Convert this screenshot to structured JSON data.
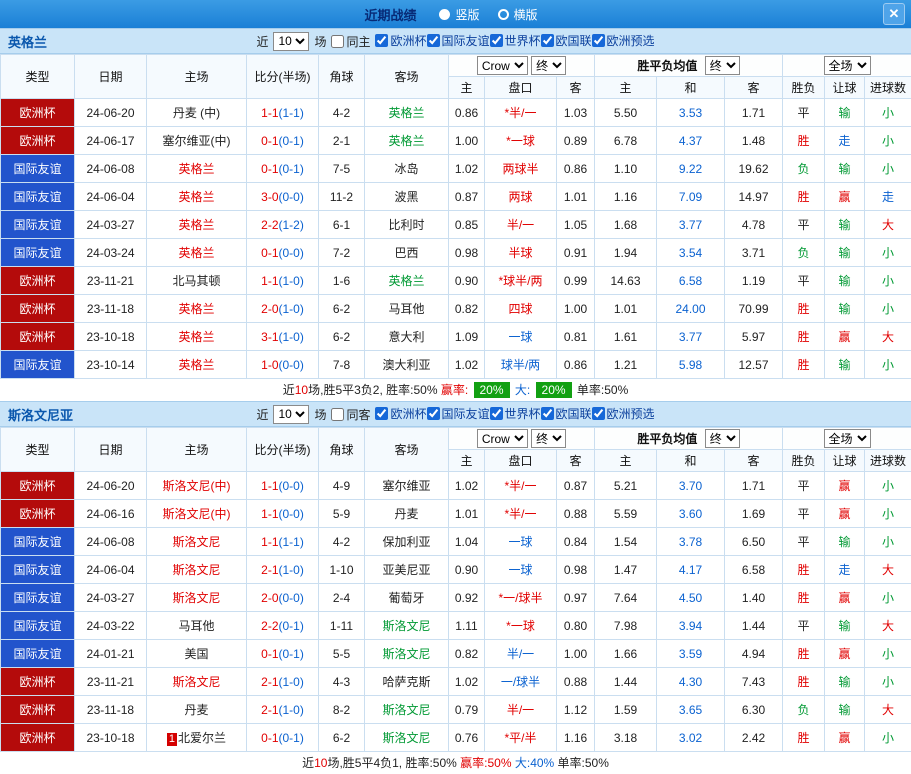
{
  "topbar": {
    "title": "近期战绩",
    "vertical_label": "竖版",
    "horizontal_label": "横版",
    "close_glyph": "✕"
  },
  "controls": {
    "crow_source": "Crow",
    "final_label": "终",
    "avg_label": "胜平负均值",
    "scope_label": "全场"
  },
  "filters": {
    "near_label": "近",
    "games_label": "场",
    "competitions": [
      "欧洲杯",
      "国际友谊",
      "世界杯",
      "欧国联",
      "欧洲预选"
    ],
    "comp_checked": [
      true,
      true,
      true,
      true,
      true
    ]
  },
  "columns": {
    "type": "类型",
    "date": "日期",
    "home": "主场",
    "score": "比分(半场)",
    "corner": "角球",
    "away": "客场",
    "odds_home": "主",
    "handicap": "盘口",
    "odds_away": "客",
    "avg_home": "主",
    "avg_draw": "和",
    "avg_away": "客",
    "result": "胜负",
    "handicap_result": "让球",
    "goals": "进球数"
  },
  "sections": [
    {
      "team": "英格兰",
      "count": "10",
      "same_label": "同主",
      "rows": [
        {
          "league": "欧洲杯",
          "league_color": "red",
          "date": "24-06-20",
          "home": "丹麦 (中)",
          "home_color": "black",
          "score": "1-1",
          "half": "(1-1)",
          "corners": "4-2",
          "away": "英格兰",
          "away_color": "green",
          "odds_home": "0.86",
          "handicap": "*半/一",
          "handicap_color": "red",
          "odds_away": "1.03",
          "avg_home": "5.50",
          "avg_draw": "3.53",
          "avg_away": "1.71",
          "wdl": "平",
          "wdl_color": "black",
          "hcp": "输",
          "hcp_color": "green",
          "goal": "小",
          "goal_color": "green"
        },
        {
          "league": "欧洲杯",
          "league_color": "red",
          "date": "24-06-17",
          "home": "塞尔维亚(中)",
          "home_color": "black",
          "score": "0-1",
          "half": "(0-1)",
          "corners": "2-1",
          "away": "英格兰",
          "away_color": "green",
          "odds_home": "1.00",
          "handicap": "*一球",
          "handicap_color": "red",
          "odds_away": "0.89",
          "avg_home": "6.78",
          "avg_draw": "4.37",
          "avg_away": "1.48",
          "wdl": "胜",
          "wdl_color": "red",
          "hcp": "走",
          "hcp_color": "blue",
          "goal": "小",
          "goal_color": "green"
        },
        {
          "league": "国际友谊",
          "league_color": "blue",
          "date": "24-06-08",
          "home": "英格兰",
          "home_color": "red",
          "score": "0-1",
          "half": "(0-1)",
          "corners": "7-5",
          "away": "冰岛",
          "away_color": "black",
          "odds_home": "1.02",
          "handicap": "两球半",
          "handicap_color": "red",
          "odds_away": "0.86",
          "avg_home": "1.10",
          "avg_draw": "9.22",
          "avg_away": "19.62",
          "wdl": "负",
          "wdl_color": "green",
          "hcp": "输",
          "hcp_color": "green",
          "goal": "小",
          "goal_color": "green"
        },
        {
          "league": "国际友谊",
          "league_color": "blue",
          "date": "24-06-04",
          "home": "英格兰",
          "home_color": "red",
          "score": "3-0",
          "half": "(0-0)",
          "corners": "11-2",
          "away": "波黑",
          "away_color": "black",
          "odds_home": "0.87",
          "handicap": "两球",
          "handicap_color": "red",
          "odds_away": "1.01",
          "avg_home": "1.16",
          "avg_draw": "7.09",
          "avg_away": "14.97",
          "wdl": "胜",
          "wdl_color": "red",
          "hcp": "赢",
          "hcp_color": "red",
          "goal": "走",
          "goal_color": "blue"
        },
        {
          "league": "国际友谊",
          "league_color": "blue",
          "date": "24-03-27",
          "home": "英格兰",
          "home_color": "red",
          "score": "2-2",
          "half": "(1-2)",
          "corners": "6-1",
          "away": "比利时",
          "away_color": "black",
          "odds_home": "0.85",
          "handicap": "半/一",
          "handicap_color": "red",
          "odds_away": "1.05",
          "avg_home": "1.68",
          "avg_draw": "3.77",
          "avg_away": "4.78",
          "wdl": "平",
          "wdl_color": "black",
          "hcp": "输",
          "hcp_color": "green",
          "goal": "大",
          "goal_color": "red"
        },
        {
          "league": "国际友谊",
          "league_color": "blue",
          "date": "24-03-24",
          "home": "英格兰",
          "home_color": "red",
          "score": "0-1",
          "half": "(0-0)",
          "corners": "7-2",
          "away": "巴西",
          "away_color": "black",
          "odds_home": "0.98",
          "handicap": "半球",
          "handicap_color": "red",
          "odds_away": "0.91",
          "avg_home": "1.94",
          "avg_draw": "3.54",
          "avg_away": "3.71",
          "wdl": "负",
          "wdl_color": "green",
          "hcp": "输",
          "hcp_color": "green",
          "goal": "小",
          "goal_color": "green"
        },
        {
          "league": "欧洲杯",
          "league_color": "red",
          "date": "23-11-21",
          "home": "北马其顿",
          "home_color": "black",
          "score": "1-1",
          "half": "(1-0)",
          "corners": "1-6",
          "away": "英格兰",
          "away_color": "green",
          "odds_home": "0.90",
          "handicap": "*球半/两",
          "handicap_color": "red",
          "odds_away": "0.99",
          "avg_home": "14.63",
          "avg_draw": "6.58",
          "avg_away": "1.19",
          "wdl": "平",
          "wdl_color": "black",
          "hcp": "输",
          "hcp_color": "green",
          "goal": "小",
          "goal_color": "green"
        },
        {
          "league": "欧洲杯",
          "league_color": "red",
          "date": "23-11-18",
          "home": "英格兰",
          "home_color": "red",
          "score": "2-0",
          "half": "(1-0)",
          "corners": "6-2",
          "away": "马耳他",
          "away_color": "black",
          "odds_home": "0.82",
          "handicap": "四球",
          "handicap_color": "red",
          "odds_away": "1.00",
          "avg_home": "1.01",
          "avg_draw": "24.00",
          "avg_away": "70.99",
          "wdl": "胜",
          "wdl_color": "red",
          "hcp": "输",
          "hcp_color": "green",
          "goal": "小",
          "goal_color": "green"
        },
        {
          "league": "欧洲杯",
          "league_color": "red",
          "date": "23-10-18",
          "home": "英格兰",
          "home_color": "red",
          "score": "3-1",
          "half": "(1-0)",
          "corners": "6-2",
          "away": "意大利",
          "away_color": "black",
          "odds_home": "1.09",
          "handicap": "一球",
          "handicap_color": "blue",
          "odds_away": "0.81",
          "avg_home": "1.61",
          "avg_draw": "3.77",
          "avg_away": "5.97",
          "wdl": "胜",
          "wdl_color": "red",
          "hcp": "赢",
          "hcp_color": "red",
          "goal": "大",
          "goal_color": "red"
        },
        {
          "league": "国际友谊",
          "league_color": "blue",
          "date": "23-10-14",
          "home": "英格兰",
          "home_color": "red",
          "score": "1-0",
          "half": "(0-0)",
          "corners": "7-8",
          "away": "澳大利亚",
          "away_color": "black",
          "odds_home": "1.02",
          "handicap": "球半/两",
          "handicap_color": "blue",
          "odds_away": "0.86",
          "avg_home": "1.21",
          "avg_draw": "5.98",
          "avg_away": "12.57",
          "wdl": "胜",
          "wdl_color": "red",
          "hcp": "输",
          "hcp_color": "green",
          "goal": "小",
          "goal_color": "green"
        }
      ],
      "summary": [
        {
          "text": "近",
          "color": "black"
        },
        {
          "text": "10",
          "color": "red"
        },
        {
          "text": "场,胜5平3负2, 胜率:50% ",
          "color": "black"
        },
        {
          "text": "赢率: ",
          "color": "red"
        },
        {
          "text": "20%",
          "badge": true
        },
        {
          "text": " 大: ",
          "color": "blue"
        },
        {
          "text": "20%",
          "badge": true
        },
        {
          "text": " 单率:50%",
          "color": "black"
        }
      ]
    },
    {
      "team": "斯洛文尼亚",
      "count": "10",
      "same_label": "同客",
      "rows": [
        {
          "league": "欧洲杯",
          "league_color": "red",
          "date": "24-06-20",
          "home": "斯洛文尼(中)",
          "home_color": "red",
          "score": "1-1",
          "half": "(0-0)",
          "corners": "4-9",
          "away": "塞尔维亚",
          "away_color": "black",
          "odds_home": "1.02",
          "handicap": "*半/一",
          "handicap_color": "red",
          "odds_away": "0.87",
          "avg_home": "5.21",
          "avg_draw": "3.70",
          "avg_away": "1.71",
          "wdl": "平",
          "wdl_color": "black",
          "hcp": "赢",
          "hcp_color": "red",
          "goal": "小",
          "goal_color": "green"
        },
        {
          "league": "欧洲杯",
          "league_color": "red",
          "date": "24-06-16",
          "home": "斯洛文尼(中)",
          "home_color": "red",
          "score": "1-1",
          "half": "(0-0)",
          "corners": "5-9",
          "away": "丹麦",
          "away_color": "black",
          "odds_home": "1.01",
          "handicap": "*半/一",
          "handicap_color": "red",
          "odds_away": "0.88",
          "avg_home": "5.59",
          "avg_draw": "3.60",
          "avg_away": "1.69",
          "wdl": "平",
          "wdl_color": "black",
          "hcp": "赢",
          "hcp_color": "red",
          "goal": "小",
          "goal_color": "green"
        },
        {
          "league": "国际友谊",
          "league_color": "blue",
          "date": "24-06-08",
          "home": "斯洛文尼",
          "home_color": "red",
          "score": "1-1",
          "half": "(1-1)",
          "corners": "4-2",
          "away": "保加利亚",
          "away_color": "black",
          "odds_home": "1.04",
          "handicap": "一球",
          "handicap_color": "blue",
          "odds_away": "0.84",
          "avg_home": "1.54",
          "avg_draw": "3.78",
          "avg_away": "6.50",
          "wdl": "平",
          "wdl_color": "black",
          "hcp": "输",
          "hcp_color": "green",
          "goal": "小",
          "goal_color": "green"
        },
        {
          "league": "国际友谊",
          "league_color": "blue",
          "date": "24-06-04",
          "home": "斯洛文尼",
          "home_color": "red",
          "score": "2-1",
          "half": "(1-0)",
          "corners": "1-10",
          "away": "亚美尼亚",
          "away_color": "black",
          "odds_home": "0.90",
          "handicap": "一球",
          "handicap_color": "blue",
          "odds_away": "0.98",
          "avg_home": "1.47",
          "avg_draw": "4.17",
          "avg_away": "6.58",
          "wdl": "胜",
          "wdl_color": "red",
          "hcp": "走",
          "hcp_color": "blue",
          "goal": "大",
          "goal_color": "red"
        },
        {
          "league": "国际友谊",
          "league_color": "blue",
          "date": "24-03-27",
          "home": "斯洛文尼",
          "home_color": "red",
          "score": "2-0",
          "half": "(0-0)",
          "corners": "2-4",
          "away": "葡萄牙",
          "away_color": "black",
          "odds_home": "0.92",
          "handicap": "*一/球半",
          "handicap_color": "red",
          "odds_away": "0.97",
          "avg_home": "7.64",
          "avg_draw": "4.50",
          "avg_away": "1.40",
          "wdl": "胜",
          "wdl_color": "red",
          "hcp": "赢",
          "hcp_color": "red",
          "goal": "小",
          "goal_color": "green"
        },
        {
          "league": "国际友谊",
          "league_color": "blue",
          "date": "24-03-22",
          "home": "马耳他",
          "home_color": "black",
          "score": "2-2",
          "half": "(0-1)",
          "corners": "1-11",
          "away": "斯洛文尼",
          "away_color": "green",
          "odds_home": "1.11",
          "handicap": "*一球",
          "handicap_color": "red",
          "odds_away": "0.80",
          "avg_home": "7.98",
          "avg_draw": "3.94",
          "avg_away": "1.44",
          "wdl": "平",
          "wdl_color": "black",
          "hcp": "输",
          "hcp_color": "green",
          "goal": "大",
          "goal_color": "red"
        },
        {
          "league": "国际友谊",
          "league_color": "blue",
          "date": "24-01-21",
          "home": "美国",
          "home_color": "black",
          "score": "0-1",
          "half": "(0-1)",
          "corners": "5-5",
          "away": "斯洛文尼",
          "away_color": "green",
          "odds_home": "0.82",
          "handicap": "半/一",
          "handicap_color": "blue",
          "odds_away": "1.00",
          "avg_home": "1.66",
          "avg_draw": "3.59",
          "avg_away": "4.94",
          "wdl": "胜",
          "wdl_color": "red",
          "hcp": "赢",
          "hcp_color": "red",
          "goal": "小",
          "goal_color": "green"
        },
        {
          "league": "欧洲杯",
          "league_color": "red",
          "date": "23-11-21",
          "home": "斯洛文尼",
          "home_color": "red",
          "score": "2-1",
          "half": "(1-0)",
          "corners": "4-3",
          "away": "哈萨克斯",
          "away_color": "black",
          "odds_home": "1.02",
          "handicap": "一/球半",
          "handicap_color": "blue",
          "odds_away": "0.88",
          "avg_home": "1.44",
          "avg_draw": "4.30",
          "avg_away": "7.43",
          "wdl": "胜",
          "wdl_color": "red",
          "hcp": "输",
          "hcp_color": "green",
          "goal": "小",
          "goal_color": "green"
        },
        {
          "league": "欧洲杯",
          "league_color": "red",
          "date": "23-11-18",
          "home": "丹麦",
          "home_color": "black",
          "score": "2-1",
          "half": "(1-0)",
          "corners": "8-2",
          "away": "斯洛文尼",
          "away_color": "green",
          "odds_home": "0.79",
          "handicap": "半/一",
          "handicap_color": "red",
          "odds_away": "1.12",
          "avg_home": "1.59",
          "avg_draw": "3.65",
          "avg_away": "6.30",
          "wdl": "负",
          "wdl_color": "green",
          "hcp": "输",
          "hcp_color": "green",
          "goal": "大",
          "goal_color": "red"
        },
        {
          "league": "欧洲杯",
          "league_color": "red",
          "date": "23-10-18",
          "home": "北爱尔兰",
          "home_badge": "1",
          "home_color": "black",
          "score": "0-1",
          "half": "(0-1)",
          "corners": "6-2",
          "away": "斯洛文尼",
          "away_color": "green",
          "odds_home": "0.76",
          "handicap": "*平/半",
          "handicap_color": "red",
          "odds_away": "1.16",
          "avg_home": "3.18",
          "avg_draw": "3.02",
          "avg_away": "2.42",
          "wdl": "胜",
          "wdl_color": "red",
          "hcp": "赢",
          "hcp_color": "red",
          "goal": "小",
          "goal_color": "green"
        }
      ],
      "summary": [
        {
          "text": "近",
          "color": "black"
        },
        {
          "text": "10",
          "color": "red"
        },
        {
          "text": "场,胜5平4负1, 胜率:50% ",
          "color": "black"
        },
        {
          "text": "赢率:50%",
          "color": "red"
        },
        {
          "text": " 大:40%",
          "color": "blue"
        },
        {
          "text": " 单率:50%",
          "color": "black"
        }
      ]
    }
  ]
}
